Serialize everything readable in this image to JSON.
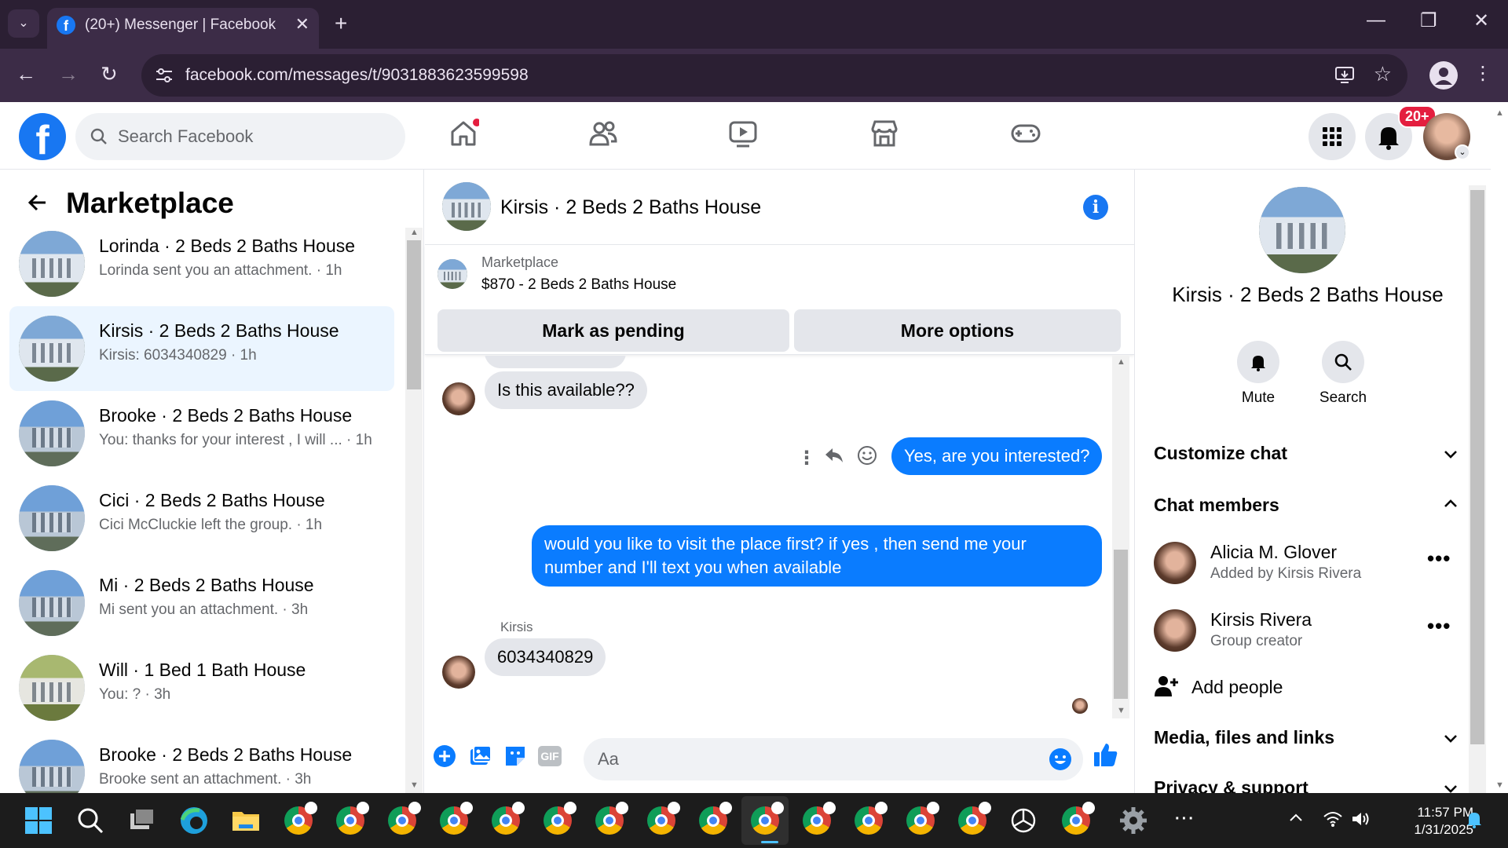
{
  "browser": {
    "tab_title": "(20+) Messenger | Facebook",
    "url": "facebook.com/messages/t/9031883623599598",
    "new_tab": "+",
    "tab_close": "✕"
  },
  "fb": {
    "logo": "f",
    "search_placeholder": "Search Facebook",
    "notif_badge": "20+"
  },
  "sidebar": {
    "title": "Marketplace",
    "items": [
      {
        "name": "Lorinda · 2 Beds 2 Baths House",
        "sub": "Lorinda sent you an attachment. · 1h"
      },
      {
        "name": "Kirsis · 2 Beds 2 Baths House",
        "sub": "Kirsis: 6034340829 · 1h"
      },
      {
        "name": "Brooke · 2 Beds 2 Baths House",
        "sub": "You: thanks for your interest , I will ... · 1h"
      },
      {
        "name": "Cici · 2 Beds 2 Baths House",
        "sub": "Cici McCluckie left the group. · 1h"
      },
      {
        "name": "Mi · 2 Beds 2 Baths House",
        "sub": "Mi sent you an attachment. · 3h"
      },
      {
        "name": "Will · 1 Bed 1 Bath House",
        "sub": "You: ? · 3h"
      },
      {
        "name": "Brooke · 2 Beds 2 Baths House",
        "sub": "Brooke sent an attachment. · 3h"
      }
    ]
  },
  "chat": {
    "title": "Kirsis · 2 Beds 2 Baths House",
    "info": "i",
    "listing_label": "Marketplace",
    "listing_price": "$870 - 2 Beds 2 Baths House",
    "mark_pending": "Mark as pending",
    "more_options": "More options",
    "messages": [
      {
        "text": "Is this available??"
      },
      {
        "text": "Yes, are you interested?"
      },
      {
        "text": "would you like to visit the place first? if yes , then send me your number and I'll text you when available"
      },
      {
        "sender": "Kirsis",
        "text": "6034340829"
      }
    ],
    "composer_placeholder": "Aa",
    "gif": "GIF"
  },
  "details": {
    "name": "Kirsis · 2 Beds 2 Baths House",
    "mute": "Mute",
    "search": "Search",
    "customize": "Customize chat",
    "members_title": "Chat members",
    "members": [
      {
        "name": "Alicia M. Glover",
        "sub": "Added by Kirsis Rivera"
      },
      {
        "name": "Kirsis Rivera",
        "sub": "Group creator"
      }
    ],
    "add_people": "Add people",
    "media": "Media, files and links",
    "privacy": "Privacy & support",
    "more": "•••"
  },
  "taskbar": {
    "time": "11:57 PM",
    "date": "1/31/2025"
  },
  "colors": {
    "fb_blue": "#1877f2",
    "outgoing": "#0a7cff",
    "active_row": "#ebf5ff"
  }
}
